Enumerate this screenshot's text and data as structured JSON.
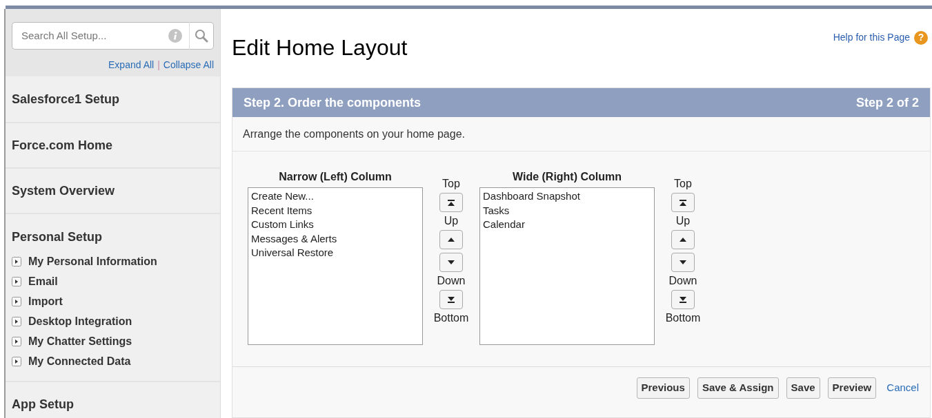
{
  "sidebar": {
    "search": {
      "placeholder": "Search All Setup..."
    },
    "links": [
      "Expand All",
      "|",
      "Collapse All"
    ],
    "sections": [
      {
        "title": "Salesforce1 Setup"
      },
      {
        "title": "Force.com Home"
      },
      {
        "title": "System Overview"
      },
      {
        "title": "Personal Setup",
        "items": [
          "My Personal Information",
          "Email",
          "Import",
          "Desktop Integration",
          "My Chatter Settings",
          "My Connected Data"
        ]
      },
      {
        "title": "App Setup"
      }
    ]
  },
  "page": {
    "title": "Edit Home Layout",
    "help_link": "Help for this Page",
    "help_icon": "?"
  },
  "panel": {
    "step_title": "Step 2. Order the components",
    "step_count": "Step 2 of 2",
    "description": "Arrange the components on your home page.",
    "columns": [
      {
        "heading": "Narrow (Left) Column",
        "items": [
          "Create New...",
          "Recent Items",
          "Custom Links",
          "Messages & Alerts",
          "Universal Restore"
        ],
        "controls": [
          {
            "kind": "label",
            "text": "Top"
          },
          {
            "kind": "top"
          },
          {
            "kind": "label",
            "text": "Up"
          },
          {
            "kind": "up"
          },
          {
            "kind": "down"
          },
          {
            "kind": "label",
            "text": "Down"
          },
          {
            "kind": "bottom"
          },
          {
            "kind": "label",
            "text": "Bottom"
          }
        ]
      },
      {
        "heading": "Wide (Right) Column",
        "items": [
          "Dashboard Snapshot",
          "Tasks",
          "Calendar"
        ],
        "controls": [
          {
            "kind": "label",
            "text": "Top"
          },
          {
            "kind": "top"
          },
          {
            "kind": "label",
            "text": "Up"
          },
          {
            "kind": "up"
          },
          {
            "kind": "down"
          },
          {
            "kind": "label",
            "text": "Down"
          },
          {
            "kind": "bottom"
          },
          {
            "kind": "label",
            "text": "Bottom"
          }
        ]
      }
    ],
    "buttons": [
      "Previous",
      "Save & Assign",
      "Save",
      "Preview"
    ],
    "cancel": "Cancel"
  }
}
